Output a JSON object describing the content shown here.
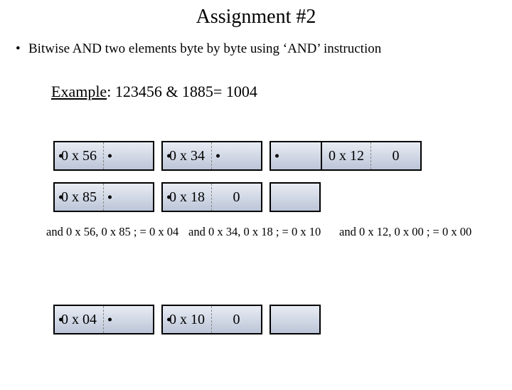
{
  "title": "Assignment #2",
  "bullet": "Bitwise AND two elements byte by byte using ‘AND’ instruction",
  "example": {
    "label": "Example",
    "text": ": 123456 & 1885= 1004"
  },
  "row1": {
    "g1": "0 x 56",
    "g2": "0 x 34",
    "g3_a": "0 x 12",
    "g3_b": "0"
  },
  "row2": {
    "g1": "0 x 85",
    "g2_a": "0 x 18",
    "g2_b": "0"
  },
  "calc": {
    "c1": "and 0 x 56, 0 x 85 ; = 0 x 04",
    "c2": "and 0 x 34, 0 x 18 ; = 0 x 10",
    "c3": "and 0 x 12, 0 x 00 ; = 0 x 00"
  },
  "result": {
    "g1": "0 x 04",
    "g2_a": "0 x 10",
    "g2_b": "0"
  }
}
